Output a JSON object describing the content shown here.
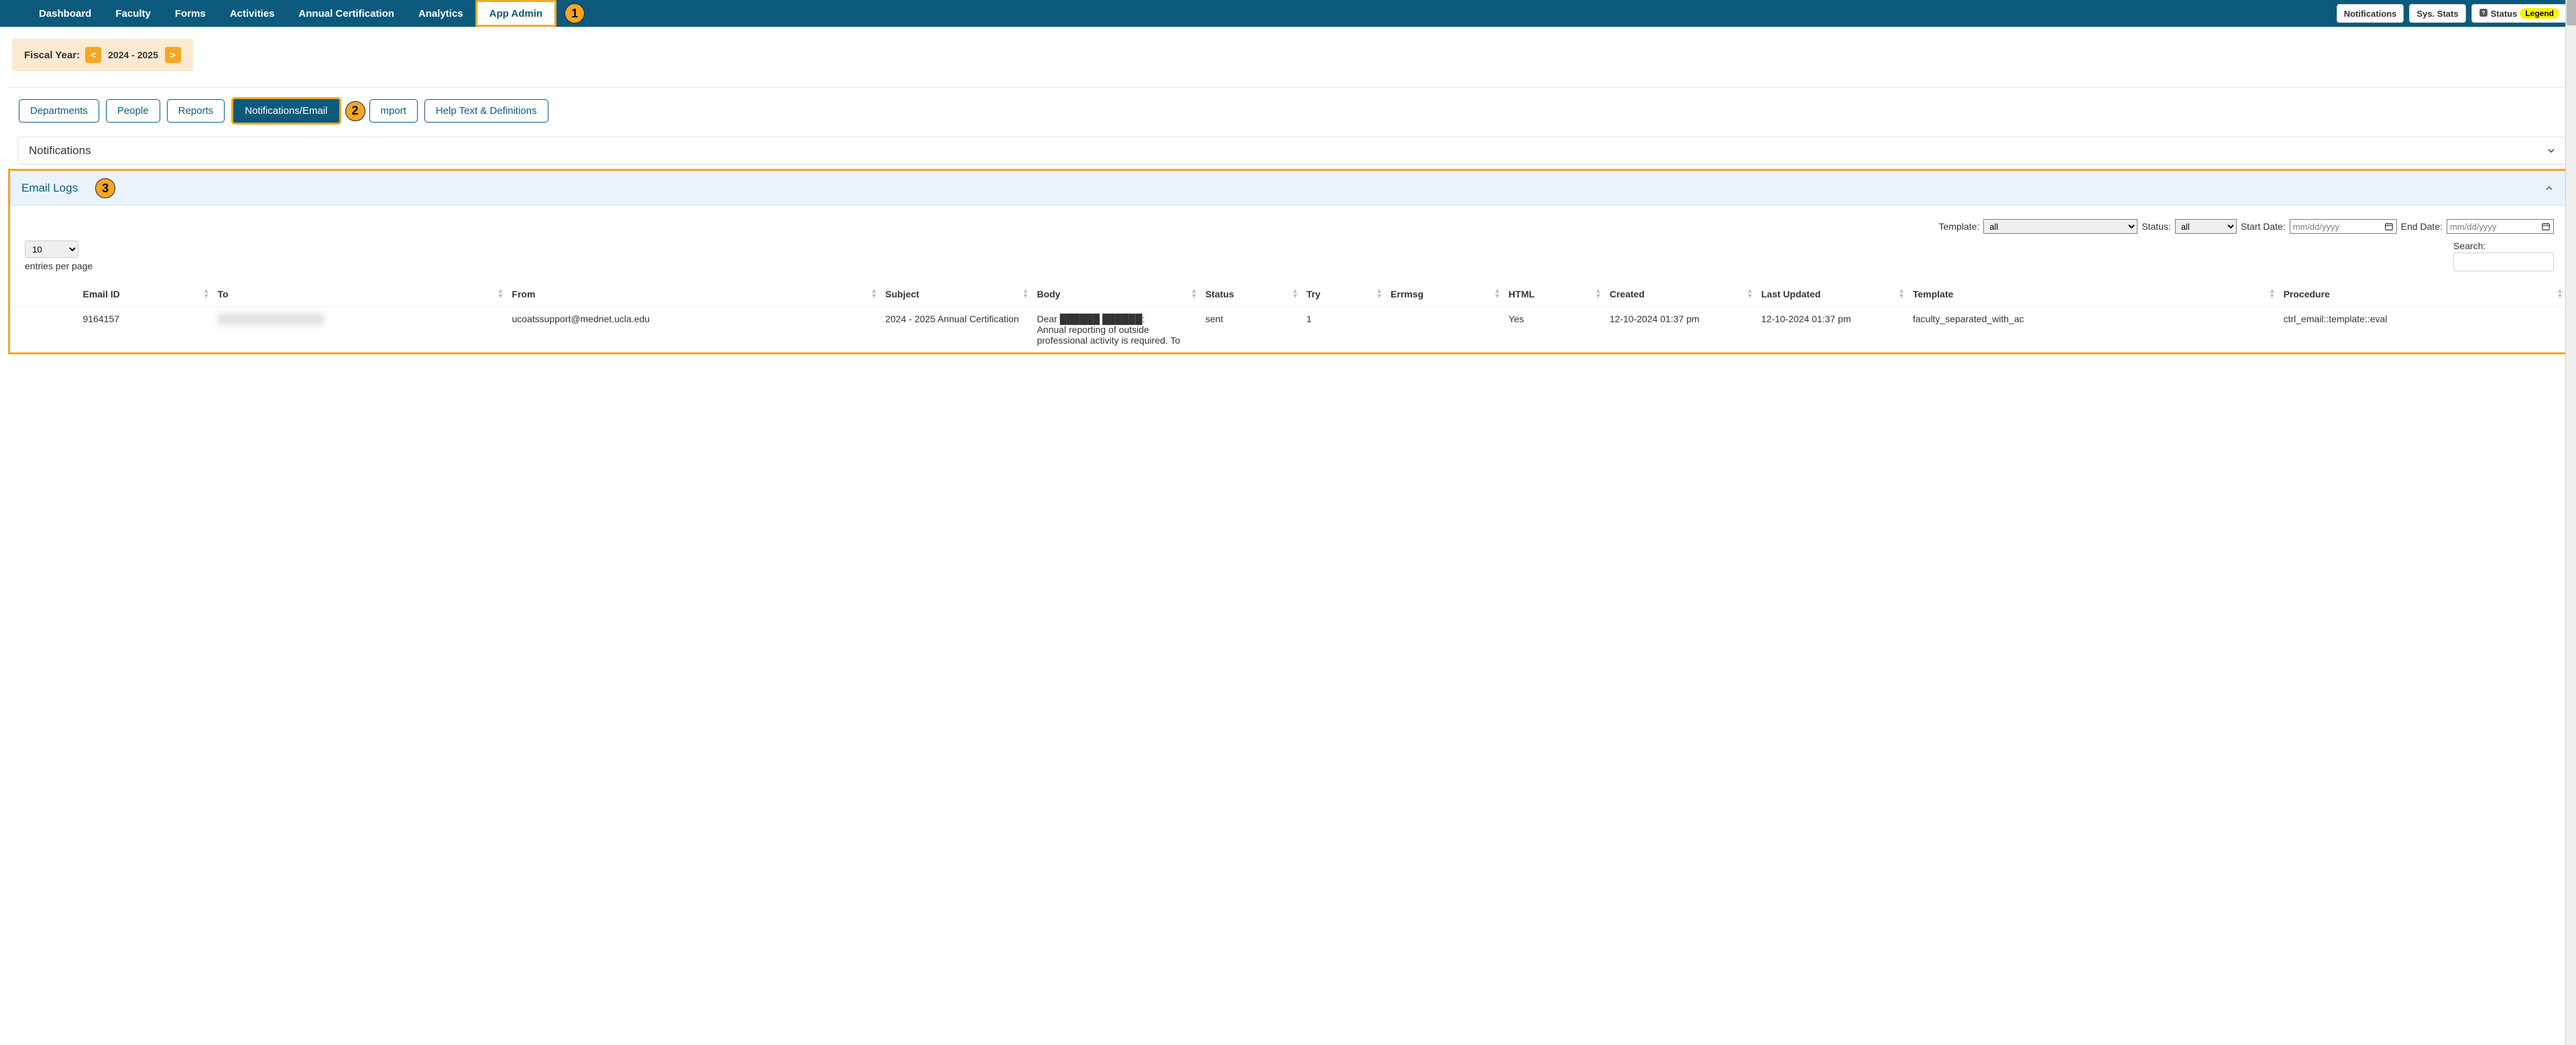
{
  "topbar": {
    "nav": [
      {
        "label": "Dashboard"
      },
      {
        "label": "Faculty"
      },
      {
        "label": "Forms"
      },
      {
        "label": "Activities"
      },
      {
        "label": "Annual Certification"
      },
      {
        "label": "Analytics"
      },
      {
        "label": "App Admin",
        "active": true
      }
    ],
    "callout1": "1",
    "right_buttons": {
      "notifications": "Notifications",
      "sysstats": "Sys. Stats",
      "status": "Status",
      "legend": "Legend"
    }
  },
  "fiscal_year": {
    "label": "Fiscal Year:",
    "prev": "<",
    "value": "2024 - 2025",
    "next": ">"
  },
  "subtabs": {
    "items": [
      {
        "label": "Departments"
      },
      {
        "label": "People"
      },
      {
        "label": "Reports"
      },
      {
        "label": "Notifications/Email",
        "active": true
      },
      {
        "label": "mport"
      },
      {
        "label": "Help Text & Definitions"
      }
    ],
    "callout2": "2"
  },
  "notifications_section": {
    "title": "Notifications"
  },
  "email_logs": {
    "title": "Email Logs",
    "callout3": "3",
    "filters": {
      "template_label": "Template:",
      "template_value": "all",
      "status_label": "Status:",
      "status_value": "all",
      "start_label": "Start Date:",
      "start_placeholder": "mm/dd/yyyy",
      "end_label": "End Date:",
      "end_placeholder": "mm/dd/yyyy"
    },
    "entries": {
      "value": "10",
      "per_page": "entries per page",
      "search_label": "Search:"
    },
    "columns": {
      "email_id": "Email ID",
      "to": "To",
      "from": "From",
      "subject": "Subject",
      "body": "Body",
      "status": "Status",
      "try": "Try",
      "errmsg": "Errmsg",
      "html": "HTML",
      "created": "Created",
      "last_updated": "Last Updated",
      "template": "Template",
      "procedure": "Procedure"
    },
    "rows": [
      {
        "email_id": "9164157",
        "to": "████████████████",
        "from": "ucoatssupport@mednet.ucla.edu",
        "subject": "2024 - 2025 Annual Certification",
        "body": "Dear ██████ ██████:\nAnnual reporting of outside professional activity is required. To",
        "status": "sent",
        "try": "1",
        "errmsg": "",
        "html": "Yes",
        "created": "12-10-2024 01:37 pm",
        "last_updated": "12-10-2024 01:37 pm",
        "template": "faculty_separated_with_ac",
        "procedure": "ctrl_email::template::eval"
      }
    ]
  }
}
